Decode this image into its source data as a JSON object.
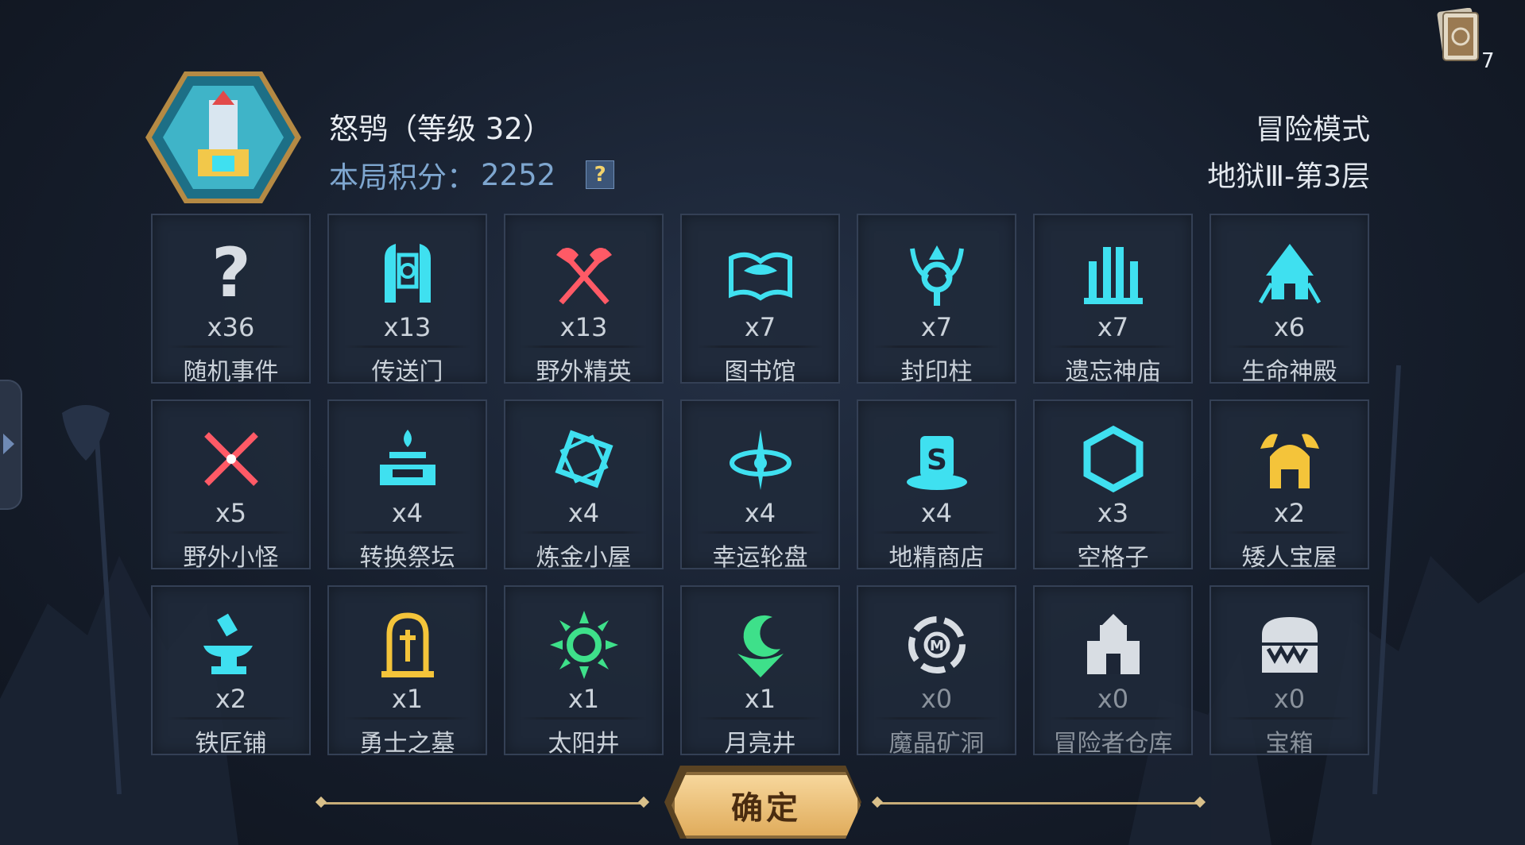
{
  "player": {
    "name": "怒鸮（等级 32）",
    "score_label": "本局积分：",
    "score_value": "2252",
    "help": "?"
  },
  "mode": {
    "title": "冒险模式",
    "stage": "地狱Ⅲ-第3层"
  },
  "deck": {
    "count": "7"
  },
  "colors": {
    "accent_cyan": "#3fe0f0",
    "accent_red": "#ff5a66",
    "accent_gold": "#f4c43a",
    "accent_green": "#3ee08a",
    "dim_white": "#d8dde3"
  },
  "tiles": [
    {
      "count": "x36",
      "name": "随机事件",
      "icon": "question-icon"
    },
    {
      "count": "x13",
      "name": "传送门",
      "icon": "portal-icon"
    },
    {
      "count": "x13",
      "name": "野外精英",
      "icon": "crossed-axes-icon"
    },
    {
      "count": "x7",
      "name": "图书馆",
      "icon": "book-icon"
    },
    {
      "count": "x7",
      "name": "封印柱",
      "icon": "seal-pillar-icon"
    },
    {
      "count": "x7",
      "name": "遗忘神庙",
      "icon": "temple-icon"
    },
    {
      "count": "x6",
      "name": "生命神殿",
      "icon": "life-shrine-icon"
    },
    {
      "count": "x5",
      "name": "野外小怪",
      "icon": "crossed-swords-icon"
    },
    {
      "count": "x4",
      "name": "转换祭坛",
      "icon": "altar-icon"
    },
    {
      "count": "x4",
      "name": "炼金小屋",
      "icon": "alchemy-icon"
    },
    {
      "count": "x4",
      "name": "幸运轮盘",
      "icon": "wheel-icon"
    },
    {
      "count": "x4",
      "name": "地精商店",
      "icon": "shop-icon"
    },
    {
      "count": "x3",
      "name": "空格子",
      "icon": "hexagon-icon"
    },
    {
      "count": "x2",
      "name": "矮人宝屋",
      "icon": "dwarf-house-icon"
    },
    {
      "count": "x2",
      "name": "铁匠铺",
      "icon": "anvil-icon"
    },
    {
      "count": "x1",
      "name": "勇士之墓",
      "icon": "tomb-icon"
    },
    {
      "count": "x1",
      "name": "太阳井",
      "icon": "sun-well-icon"
    },
    {
      "count": "x1",
      "name": "月亮井",
      "icon": "moon-well-icon"
    },
    {
      "count": "x0",
      "name": "魔晶矿洞",
      "icon": "crystal-mine-icon"
    },
    {
      "count": "x0",
      "name": "冒险者仓库",
      "icon": "warehouse-icon"
    },
    {
      "count": "x0",
      "name": "宝箱",
      "icon": "chest-icon"
    }
  ],
  "confirm_label": "确定"
}
